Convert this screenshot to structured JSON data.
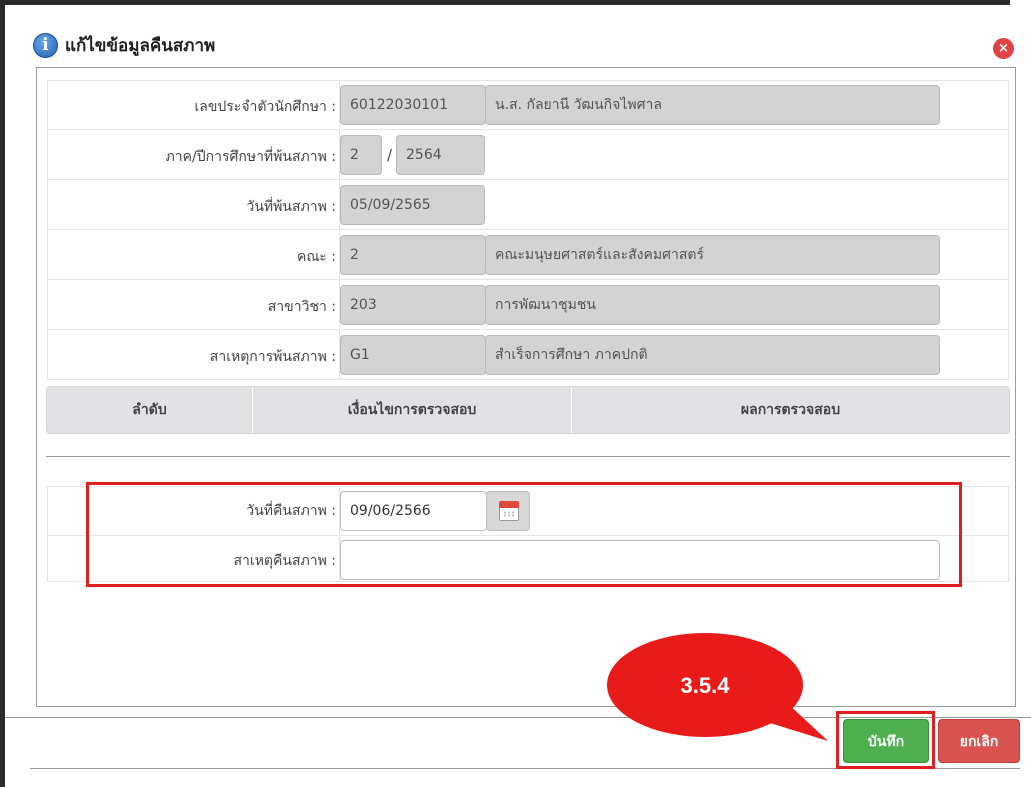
{
  "dialog": {
    "title": "แก้ไขข้อมูลคืนสภาพ",
    "info_icon_glyph": "i",
    "close_icon_glyph": "×"
  },
  "form": {
    "student_id": {
      "label": "เลขประจำตัวนักศึกษา :",
      "id_value": "60122030101",
      "name_value": "น.ส. กัลยานี วัฒนกิจไพศาล"
    },
    "term": {
      "label": "ภาค/ปีการศึกษาที่พ้นสภาพ  :",
      "semester": "2",
      "separator": "/",
      "year": "2564"
    },
    "leave_date": {
      "label": "วันที่พ้นสภาพ :",
      "value": "05/09/2565"
    },
    "faculty": {
      "label": "คณะ :",
      "code": "2",
      "name": "คณะมนุษยศาสตร์และสังคมศาสตร์"
    },
    "major": {
      "label": "สาขาวิชา :",
      "code": "203",
      "name": "การพัฒนาชุมชน"
    },
    "leave_reason": {
      "label": "สาเหตุการพ้นสภาพ :",
      "code": "G1",
      "name": "สำเร็จการศึกษา ภาคปกติ"
    }
  },
  "table": {
    "columns": [
      "ลำดับ",
      "เงื่อนไขการตรวจสอบ",
      "ผลการตรวจสอบ"
    ]
  },
  "reinstate": {
    "date": {
      "label": "วันที่คืนสภาพ :",
      "value": "09/06/2566"
    },
    "reason": {
      "label": "สาเหตุคืนสภาพ :",
      "value": ""
    }
  },
  "footer": {
    "save_label": "บันทึก",
    "cancel_label": "ยกเลิก"
  },
  "annotation": {
    "step_label": "3.5.4"
  },
  "colors": {
    "save": "#4daf4e",
    "cancel": "#d9534f",
    "highlight": "#e02020"
  }
}
